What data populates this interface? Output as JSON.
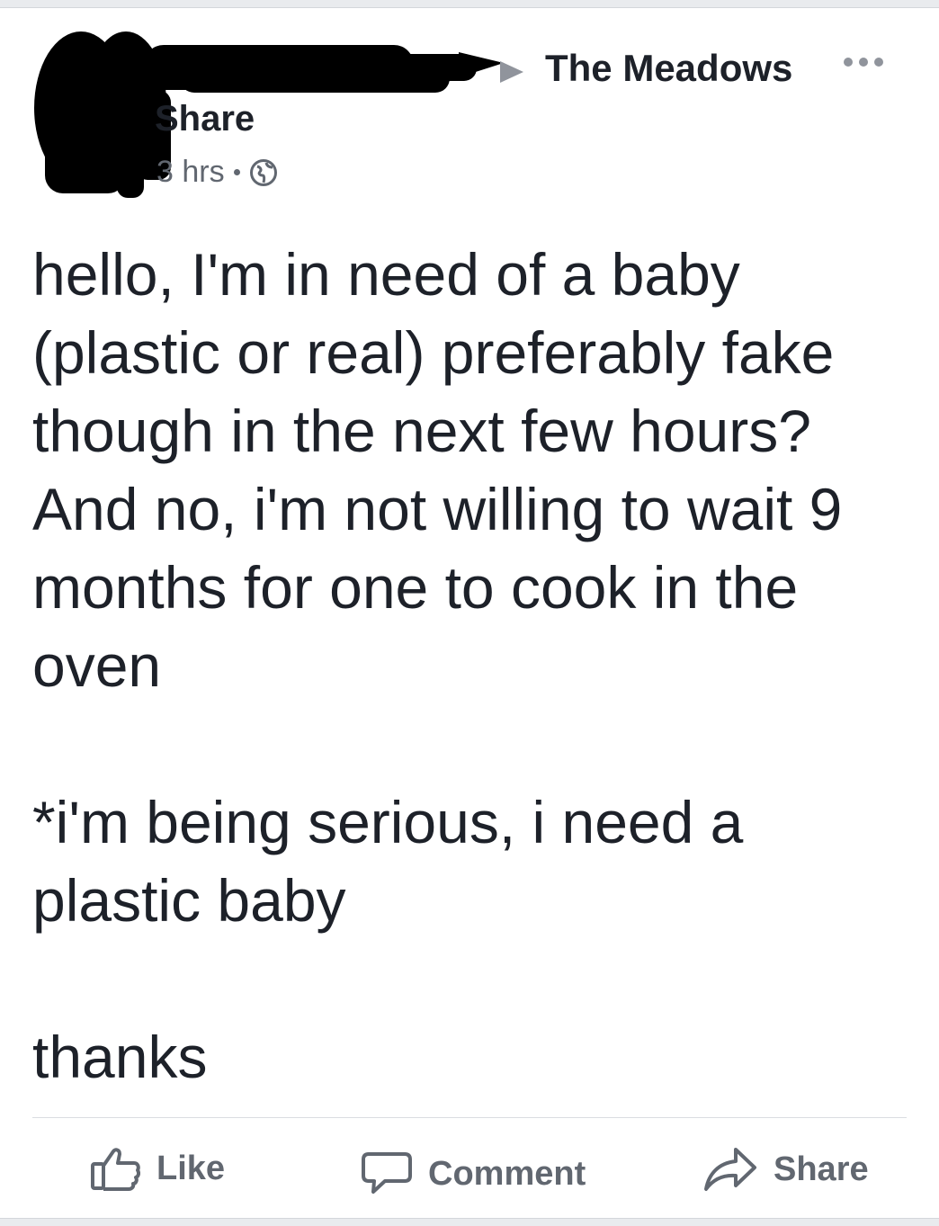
{
  "header": {
    "group_name": "The Meadows",
    "author_fragment": "Share",
    "timestamp": "3 hrs"
  },
  "post": {
    "paragraph1": "hello, I'm in need of a baby (plastic or real) preferably fake though in the next few hours? And no, i'm not willing to wait 9 months for one to cook in the oven",
    "paragraph2": "*i'm being serious, i need a plastic baby",
    "paragraph3": "thanks"
  },
  "actions": {
    "like_label": "Like",
    "comment_label": "Comment",
    "share_label": "Share"
  },
  "icons": {
    "audience": "globe-icon",
    "menu": "more-options-icon",
    "like": "thumbs-up-icon",
    "comment": "speech-bubble-icon",
    "share": "share-arrow-icon"
  },
  "colors": {
    "text": "#1d2129",
    "secondary": "#616770",
    "icon_gray": "#90949c",
    "redaction": "#000000"
  }
}
